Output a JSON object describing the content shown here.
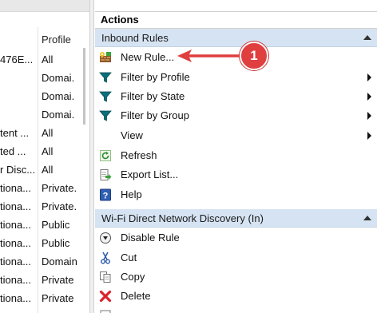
{
  "left_list": {
    "column_profile_header": "Profile",
    "rows": [
      {
        "c1": "476E...",
        "c2": "All"
      },
      {
        "c1": "",
        "c2": "Domai."
      },
      {
        "c1": "",
        "c2": "Domai."
      },
      {
        "c1": "",
        "c2": "Domai."
      },
      {
        "c1": "tent ...",
        "c2": "All"
      },
      {
        "c1": "ted ...",
        "c2": "All"
      },
      {
        "c1": "r Disc...",
        "c2": "All"
      },
      {
        "c1": "tiona...",
        "c2": "Private."
      },
      {
        "c1": "tiona...",
        "c2": "Private."
      },
      {
        "c1": "tiona...",
        "c2": "Public"
      },
      {
        "c1": "tiona...",
        "c2": "Public"
      },
      {
        "c1": "tiona...",
        "c2": "Domain"
      },
      {
        "c1": "tiona...",
        "c2": "Private"
      },
      {
        "c1": "tiona...",
        "c2": "Private"
      }
    ]
  },
  "actions": {
    "title": "Actions",
    "inbound_section": {
      "label": "Inbound Rules",
      "items": [
        {
          "label": "New Rule...",
          "icon": "new-rule-icon",
          "submenu": false
        },
        {
          "label": "Filter by Profile",
          "icon": "filter-icon",
          "submenu": true
        },
        {
          "label": "Filter by State",
          "icon": "filter-icon",
          "submenu": true
        },
        {
          "label": "Filter by Group",
          "icon": "filter-icon",
          "submenu": true
        },
        {
          "label": "View",
          "icon": "",
          "submenu": true
        },
        {
          "label": "Refresh",
          "icon": "refresh-icon",
          "submenu": false
        },
        {
          "label": "Export List...",
          "icon": "export-icon",
          "submenu": false
        },
        {
          "label": "Help",
          "icon": "help-icon",
          "submenu": false
        }
      ]
    },
    "rule_section": {
      "label": "Wi-Fi Direct Network Discovery (In)",
      "items": [
        {
          "label": "Disable Rule",
          "icon": "disable-rule-icon",
          "submenu": false
        },
        {
          "label": "Cut",
          "icon": "cut-icon",
          "submenu": false
        },
        {
          "label": "Copy",
          "icon": "copy-icon",
          "submenu": false
        },
        {
          "label": "Delete",
          "icon": "delete-icon",
          "submenu": false
        },
        {
          "label": "",
          "icon": "properties-icon",
          "submenu": false
        }
      ]
    }
  },
  "annotation": {
    "badge_number": "1",
    "color": "#e03f3f"
  },
  "colors": {
    "section_header_bg": "#d6e3f2",
    "filter_icon": "#0b6f7a",
    "delete_icon": "#d9232e"
  }
}
